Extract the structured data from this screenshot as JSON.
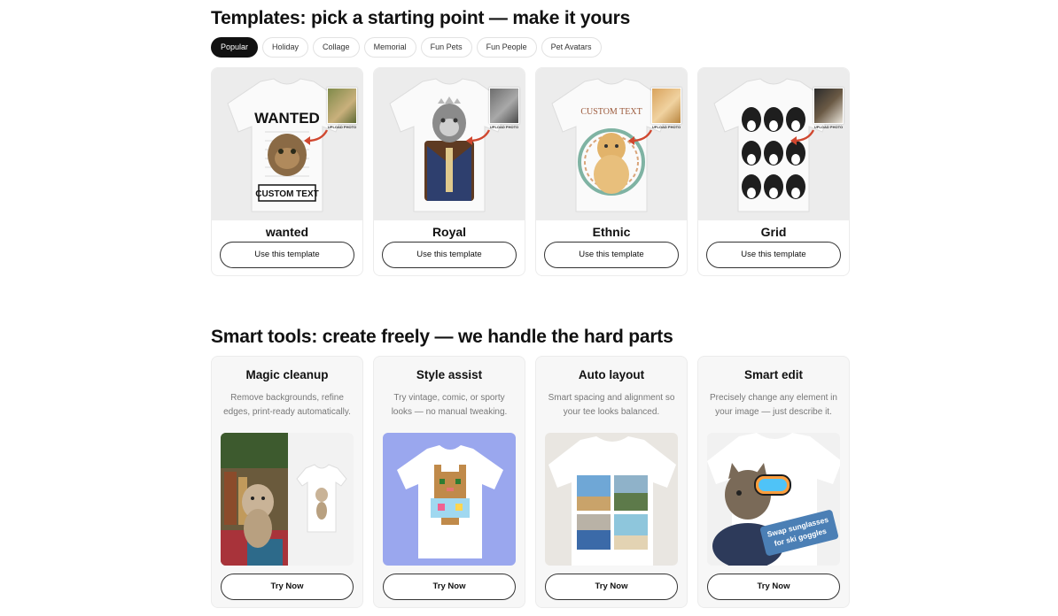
{
  "templates": {
    "heading": "Templates: pick a starting point — make it yours",
    "filters": [
      "Popular",
      "Holiday",
      "Collage",
      "Memorial",
      "Fun Pets",
      "Fun People",
      "Pet Avatars"
    ],
    "active_filter": "Popular",
    "cards": [
      {
        "name": "wanted",
        "button": "Use this template",
        "upload_label": "UPLOAD PHOTO",
        "shirt_text_top": "WANTED",
        "shirt_text_bottom": "CUSTOM TEXT"
      },
      {
        "name": "Royal",
        "button": "Use this template",
        "upload_label": "UPLOAD PHOTO"
      },
      {
        "name": "Ethnic",
        "button": "Use this template",
        "upload_label": "UPLOAD PHOTO",
        "shirt_text_top": "CUSTOM TEXT"
      },
      {
        "name": "Grid",
        "button": "Use this template",
        "upload_label": "UPLOAD PHOTO"
      }
    ]
  },
  "tools": {
    "heading": "Smart tools: create freely — we handle the hard parts",
    "cards": [
      {
        "title": "Magic cleanup",
        "desc": "Remove backgrounds, refine edges, print-ready automatically.",
        "button": "Try Now"
      },
      {
        "title": "Style assist",
        "desc": "Try vintage, comic, or sporty looks — no manual tweaking.",
        "button": "Try Now"
      },
      {
        "title": "Auto layout",
        "desc": "Smart spacing and alignment so your tee looks balanced.",
        "button": "Try Now"
      },
      {
        "title": "Smart edit",
        "desc": "Precisely change any element in your image — just describe it.",
        "button": "Try Now",
        "overlay": "Swap sunglasses for ski goggles"
      }
    ]
  },
  "colors": {
    "accent_arrow": "#d0472f",
    "style_bg": "#9aa7ee",
    "chip_active": "#111111"
  }
}
